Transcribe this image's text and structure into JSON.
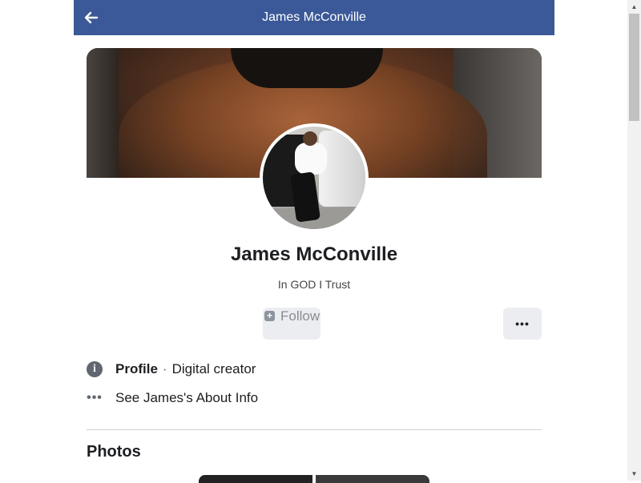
{
  "header": {
    "title": "James McConville",
    "back_icon": "arrow-left-icon"
  },
  "profile": {
    "name": "James McConville",
    "bio": "In GOD I Trust",
    "follow_label": "Follow",
    "more_label": "•••"
  },
  "info": {
    "profile_label": "Profile",
    "separator": "·",
    "category": "Digital creator",
    "about_dots": "•••",
    "about_link": "See James's About Info"
  },
  "photos": {
    "heading": "Photos"
  },
  "colors": {
    "header_bg": "#3b5998",
    "button_bg": "#ebedf0",
    "text": "#1c1e21"
  },
  "scrollbar": {
    "up": "▲",
    "down": "▼"
  }
}
